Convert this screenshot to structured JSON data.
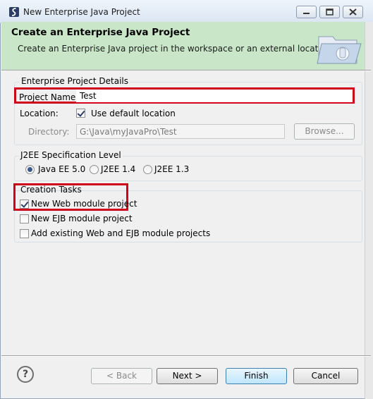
{
  "window": {
    "title": "New Enterprise Java Project",
    "controls": [
      "minimize",
      "maximize",
      "close"
    ]
  },
  "banner": {
    "title": "Create an Enterprise Java Project",
    "subtitle": "Create an Enterprise Java project in the workspace or an external location"
  },
  "details": {
    "group_label": "Enterprise Project Details",
    "project_name_label": "Project Name:",
    "project_name_value": "Test",
    "location_label": "Location:",
    "use_default_label": "Use default location",
    "use_default_checked": true,
    "directory_label": "Directory:",
    "directory_value": "G:\\Java\\myJavaPro\\Test",
    "browse_label": "Browse..."
  },
  "j2ee": {
    "group_label": "J2EE Specification Level",
    "options": [
      "Java EE 5.0",
      "J2EE 1.4",
      "J2EE 1.3"
    ],
    "selected": "Java EE 5.0"
  },
  "tasks": {
    "group_label": "Creation Tasks",
    "items": [
      {
        "label": "New Web module project",
        "checked": true
      },
      {
        "label": "New EJB module project",
        "checked": false
      },
      {
        "label": "Add existing Web and EJB module projects",
        "checked": false
      }
    ]
  },
  "footer": {
    "help_label": "?",
    "back_label": "< Back",
    "next_label": "Next >",
    "finish_label": "Finish",
    "cancel_label": "Cancel"
  },
  "colors": {
    "banner_bg": "#c9e7c8",
    "highlight_box": "#d0021b",
    "default_button": "#bee6fd"
  }
}
